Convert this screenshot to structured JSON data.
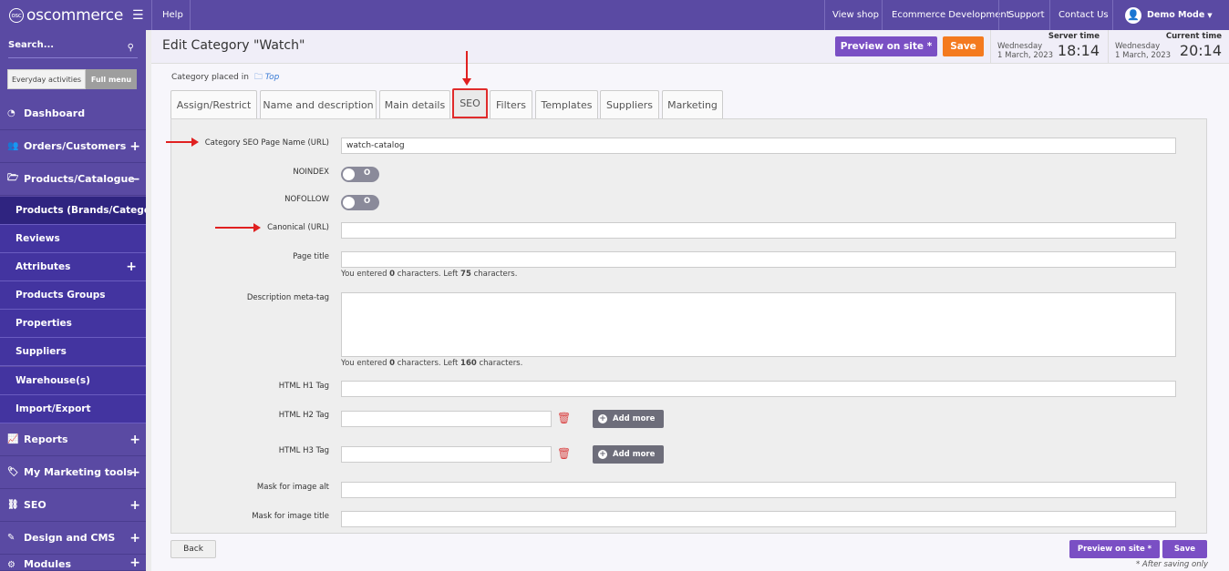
{
  "app": {
    "logo_text": "oscommerce",
    "logo_mark": "osc"
  },
  "topnav": {
    "help": "Help",
    "view_shop": "View shop",
    "ecommerce_dev": "Ecommerce Development",
    "support": "Support",
    "contact_us": "Contact Us",
    "user": "Demo Mode"
  },
  "sidebar": {
    "search_placeholder": "Search...",
    "everyday": "Everyday activities",
    "full_menu": "Full menu",
    "dashboard": "Dashboard",
    "orders": "Orders/Customers",
    "products": "Products/Catalogue",
    "subitems": [
      "Products (Brands/Catego...",
      "Reviews",
      "Attributes",
      "Products Groups",
      "Properties",
      "Suppliers",
      "Warehouse(s)",
      "Import/Export"
    ],
    "reports": "Reports",
    "marketing": "My Marketing tools",
    "seo": "SEO",
    "design": "Design and CMS",
    "modules": "Modules"
  },
  "header": {
    "title": "Edit Category \"Watch\"",
    "preview": "Preview on site *",
    "save": "Save",
    "server_label": "Server time",
    "server_day": "Wednesday",
    "server_date": "1 March, 2023",
    "server_time": "18:14",
    "current_label": "Current time",
    "current_day": "Wednesday",
    "current_date": "1 March, 2023",
    "current_time": "20:14"
  },
  "breadcrumb": {
    "prefix": "Category placed in",
    "link": "Top"
  },
  "tabs": [
    "Assign/Restrict",
    "Name and description",
    "Main details",
    "SEO",
    "Filters",
    "Templates",
    "Suppliers",
    "Marketing"
  ],
  "form": {
    "seo_name_label": "Category SEO Page Name (URL)",
    "seo_name_value": "watch-catalog",
    "noindex_label": "NOINDEX",
    "nofollow_label": "NOFOLLOW",
    "switch_off": "O",
    "canonical_label": "Canonical (URL)",
    "page_title_label": "Page title",
    "page_title_hint_1": "You entered ",
    "page_title_hint_count": "0",
    "page_title_hint_2": " characters. Left ",
    "page_title_hint_left": "75",
    "page_title_hint_3": " characters.",
    "desc_label": "Description meta-tag",
    "desc_hint_1": "You entered ",
    "desc_hint_count": "0",
    "desc_hint_2": " characters. Left ",
    "desc_hint_left": "160",
    "desc_hint_3": " characters.",
    "h1_label": "HTML H1 Tag",
    "h2_label": "HTML H2 Tag",
    "h3_label": "HTML H3 Tag",
    "add_more": "Add more",
    "mask_alt_label": "Mask for image alt",
    "mask_title_label": "Mask for image title"
  },
  "footer": {
    "back": "Back",
    "preview": "Preview on site *",
    "save": "Save",
    "note": "* After saving only"
  },
  "colors": {
    "sidebar": "#5a4aa3",
    "accent_orange": "#f47a1f",
    "accent_purple": "#7a4fc4",
    "highlight_red": "#e02b2b"
  }
}
